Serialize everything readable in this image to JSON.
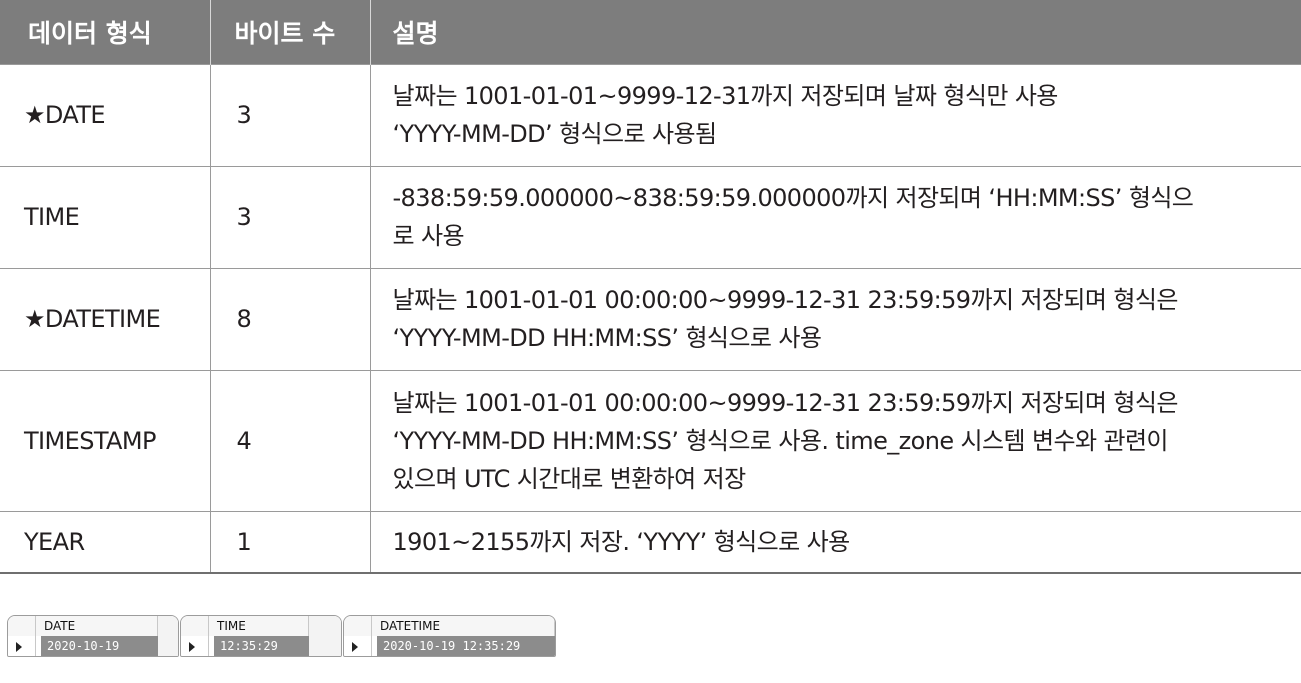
{
  "table": {
    "headers": [
      "데이터 형식",
      "바이트 수",
      "설명"
    ],
    "rows": [
      {
        "type": "★DATE",
        "bytes": "3",
        "desc": [
          "날짜는 1001-01-01~9999-12-31까지 저장되며 날짜 형식만 사용",
          "‘YYYY-MM-DD’ 형식으로 사용됨"
        ]
      },
      {
        "type": "TIME",
        "bytes": "3",
        "desc": [
          "-838:59:59.000000~838:59:59.000000까지 저장되며 ‘HH:MM:SS’ 형식으",
          "로 사용"
        ]
      },
      {
        "type": "★DATETIME",
        "bytes": "8",
        "desc": [
          "날짜는 1001-01-01 00:00:00~9999-12-31 23:59:59까지 저장되며 형식은",
          "‘YYYY-MM-DD HH:MM:SS’ 형식으로 사용"
        ]
      },
      {
        "type": "TIMESTAMP",
        "bytes": "4",
        "desc": [
          "날짜는 1001-01-01 00:00:00~9999-12-31 23:59:59까지 저장되며 형식은",
          "‘YYYY-MM-DD HH:MM:SS’ 형식으로 사용. time_zone 시스템 변수와 관련이",
          "있으며 UTC 시간대로 변환하여 저장"
        ]
      },
      {
        "type": "YEAR",
        "bytes": "1",
        "desc": [
          "1901~2155까지 저장. ‘YYYY’ 형식으로 사용"
        ]
      }
    ]
  },
  "results": [
    {
      "column": "DATE",
      "value": "2020-10-19"
    },
    {
      "column": "TIME",
      "value": "12:35:29"
    },
    {
      "column": "DATETIME",
      "value": "2020-10-19 12:35:29"
    }
  ],
  "icons": {
    "row_selector": "row-pointer-arrow-icon"
  },
  "colors": {
    "header_bg": "#7d7d7d",
    "header_text": "#ffffff",
    "cell_highlight": "#8c8c8c"
  }
}
